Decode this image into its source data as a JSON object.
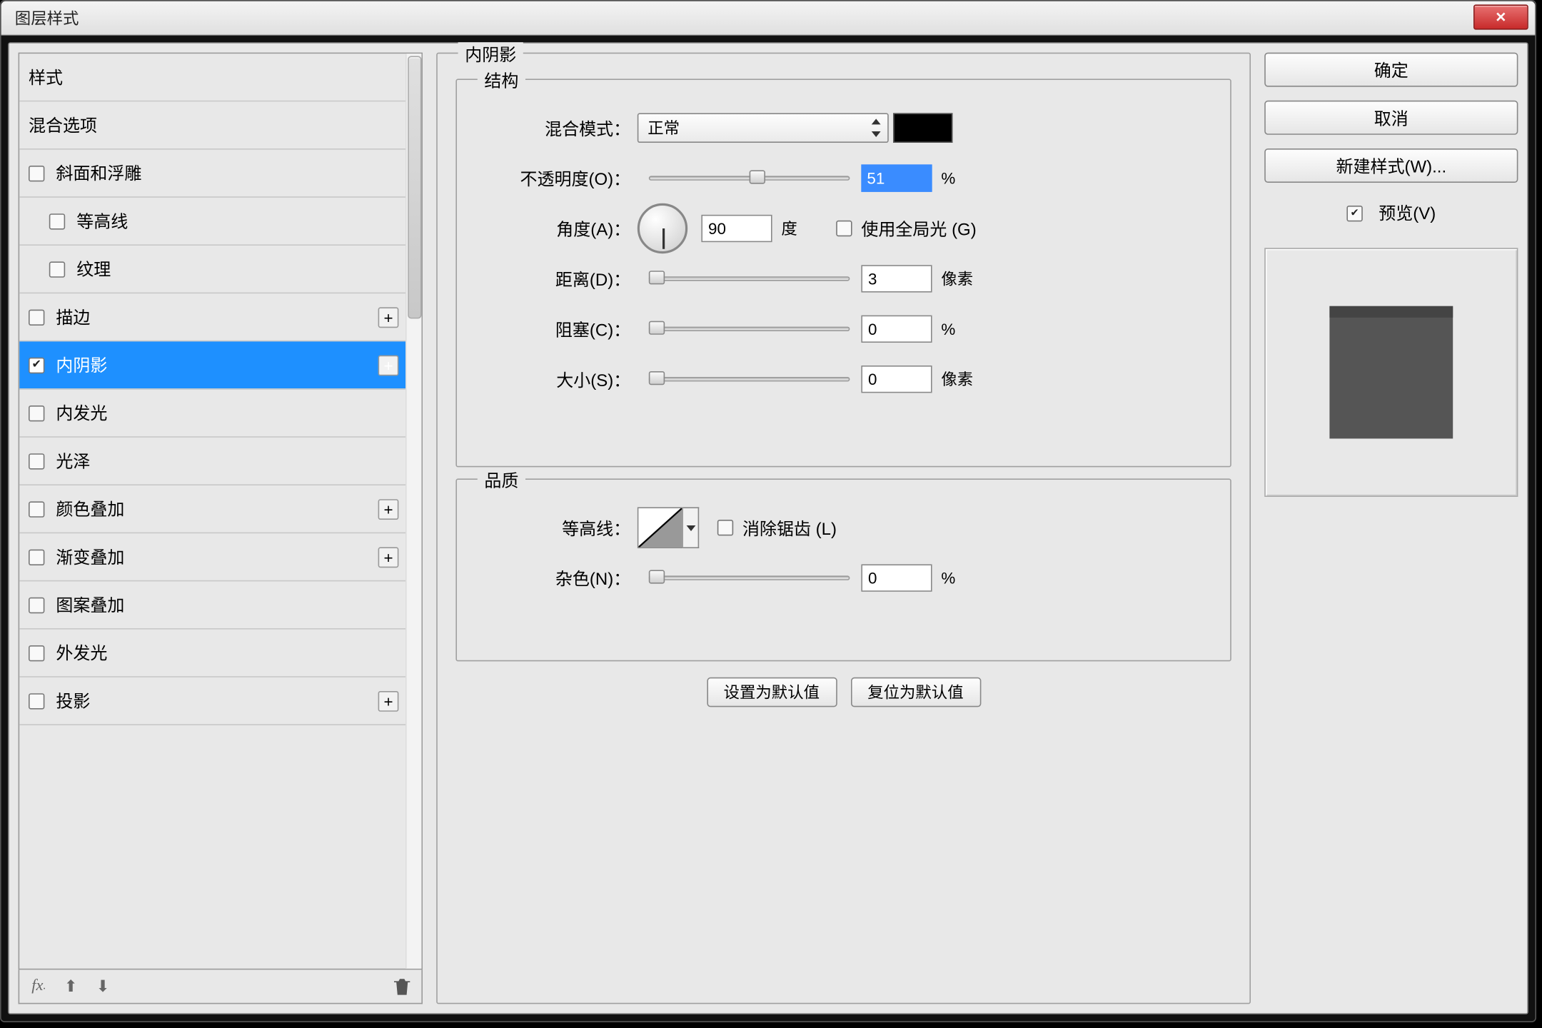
{
  "window": {
    "title": "图层样式"
  },
  "left": {
    "header_styles": "样式",
    "header_blending": "混合选项",
    "items": [
      {
        "label": "斜面和浮雕",
        "checked": false,
        "expandable": false,
        "sub": false
      },
      {
        "label": "等高线",
        "checked": false,
        "expandable": false,
        "sub": true
      },
      {
        "label": "纹理",
        "checked": false,
        "expandable": false,
        "sub": true
      },
      {
        "label": "描边",
        "checked": false,
        "expandable": true,
        "sub": false
      },
      {
        "label": "内阴影",
        "checked": true,
        "expandable": true,
        "sub": false,
        "selected": true
      },
      {
        "label": "内发光",
        "checked": false,
        "expandable": false,
        "sub": false
      },
      {
        "label": "光泽",
        "checked": false,
        "expandable": false,
        "sub": false
      },
      {
        "label": "颜色叠加",
        "checked": false,
        "expandable": true,
        "sub": false
      },
      {
        "label": "渐变叠加",
        "checked": false,
        "expandable": true,
        "sub": false
      },
      {
        "label": "图案叠加",
        "checked": false,
        "expandable": false,
        "sub": false
      },
      {
        "label": "外发光",
        "checked": false,
        "expandable": false,
        "sub": false
      },
      {
        "label": "投影",
        "checked": false,
        "expandable": true,
        "sub": false
      }
    ],
    "footer": {
      "fx": "fx",
      "trash_title": "删除"
    }
  },
  "center": {
    "group_title": "内阴影",
    "structure": {
      "legend": "结构",
      "blend_mode_label": "混合模式：",
      "blend_mode_value": "正常",
      "opacity_label": "不透明度(O)：",
      "opacity_value": "51",
      "opacity_unit": "%",
      "angle_label": "角度(A)：",
      "angle_value": "90",
      "angle_unit": "度",
      "global_light_label": "使用全局光 (G)",
      "global_light_checked": false,
      "distance_label": "距离(D)：",
      "distance_value": "3",
      "distance_unit": "像素",
      "choke_label": "阻塞(C)：",
      "choke_value": "0",
      "choke_unit": "%",
      "size_label": "大小(S)：",
      "size_value": "0",
      "size_unit": "像素"
    },
    "quality": {
      "legend": "品质",
      "contour_label": "等高线：",
      "antialias_label": "消除锯齿 (L)",
      "antialias_checked": false,
      "noise_label": "杂色(N)：",
      "noise_value": "0",
      "noise_unit": "%"
    },
    "buttons": {
      "make_default": "设置为默认值",
      "reset_default": "复位为默认值"
    }
  },
  "right": {
    "ok": "确定",
    "cancel": "取消",
    "new_style": "新建样式(W)...",
    "preview_label": "预览(V)",
    "preview_checked": true
  }
}
